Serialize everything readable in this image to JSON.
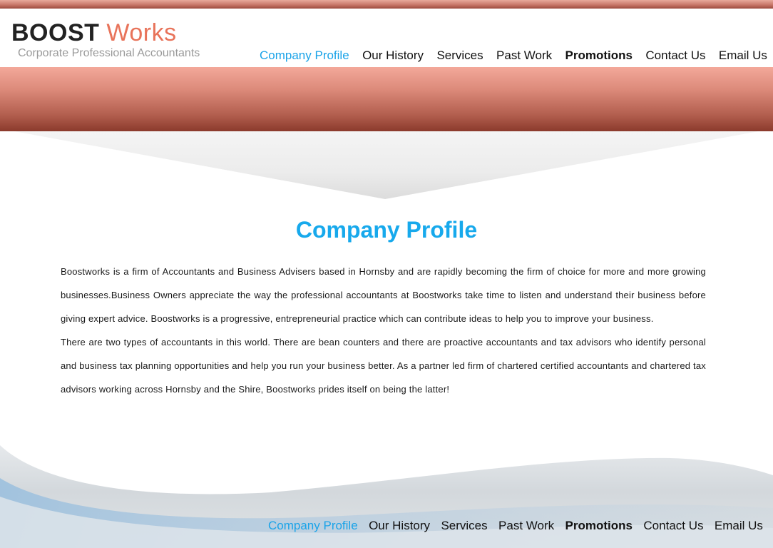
{
  "brand": {
    "name_part1": "BOOST",
    "name_part2": "Works",
    "tagline": "Corporate Professional Accountants",
    "accent_color": "#e8735a"
  },
  "nav": {
    "active_color": "#1aa3e8",
    "items": [
      {
        "label": "Company Profile",
        "active": true
      },
      {
        "label": "Our History"
      },
      {
        "label": "Services"
      },
      {
        "label": "Past Work"
      },
      {
        "label": "Promotions"
      },
      {
        "label": "Contact Us"
      },
      {
        "label": "Email Us"
      }
    ]
  },
  "main": {
    "title": "Company Profile",
    "title_color": "#17a9ec",
    "paragraphs": [
      "Boostworks is a firm of Accountants and Business Advisers based in Hornsby and are rapidly becoming the firm of choice for more and more growing businesses.Business Owners appreciate the way the professional accountants at Boostworks take time to listen and understand their business before giving expert advice. Boostworks is a progressive, entrepreneurial practice which can contribute ideas to help you to improve your business.",
      "There are two types of accountants in this world. There are bean counters and there are proactive accountants and tax advisors who identify personal and business tax planning opportunities and help you run your business better. As a partner led firm of chartered certified accountants and chartered tax advisors working across Hornsby and the Shire, Boostworks prides itself on being the latter!"
    ]
  },
  "footer_nav": {
    "items": [
      {
        "label": "Company Profile",
        "active": true
      },
      {
        "label": "Our History"
      },
      {
        "label": "Services"
      },
      {
        "label": "Past Work"
      },
      {
        "label": "Promotions"
      },
      {
        "label": "Contact Us"
      },
      {
        "label": "Email Us"
      }
    ]
  }
}
